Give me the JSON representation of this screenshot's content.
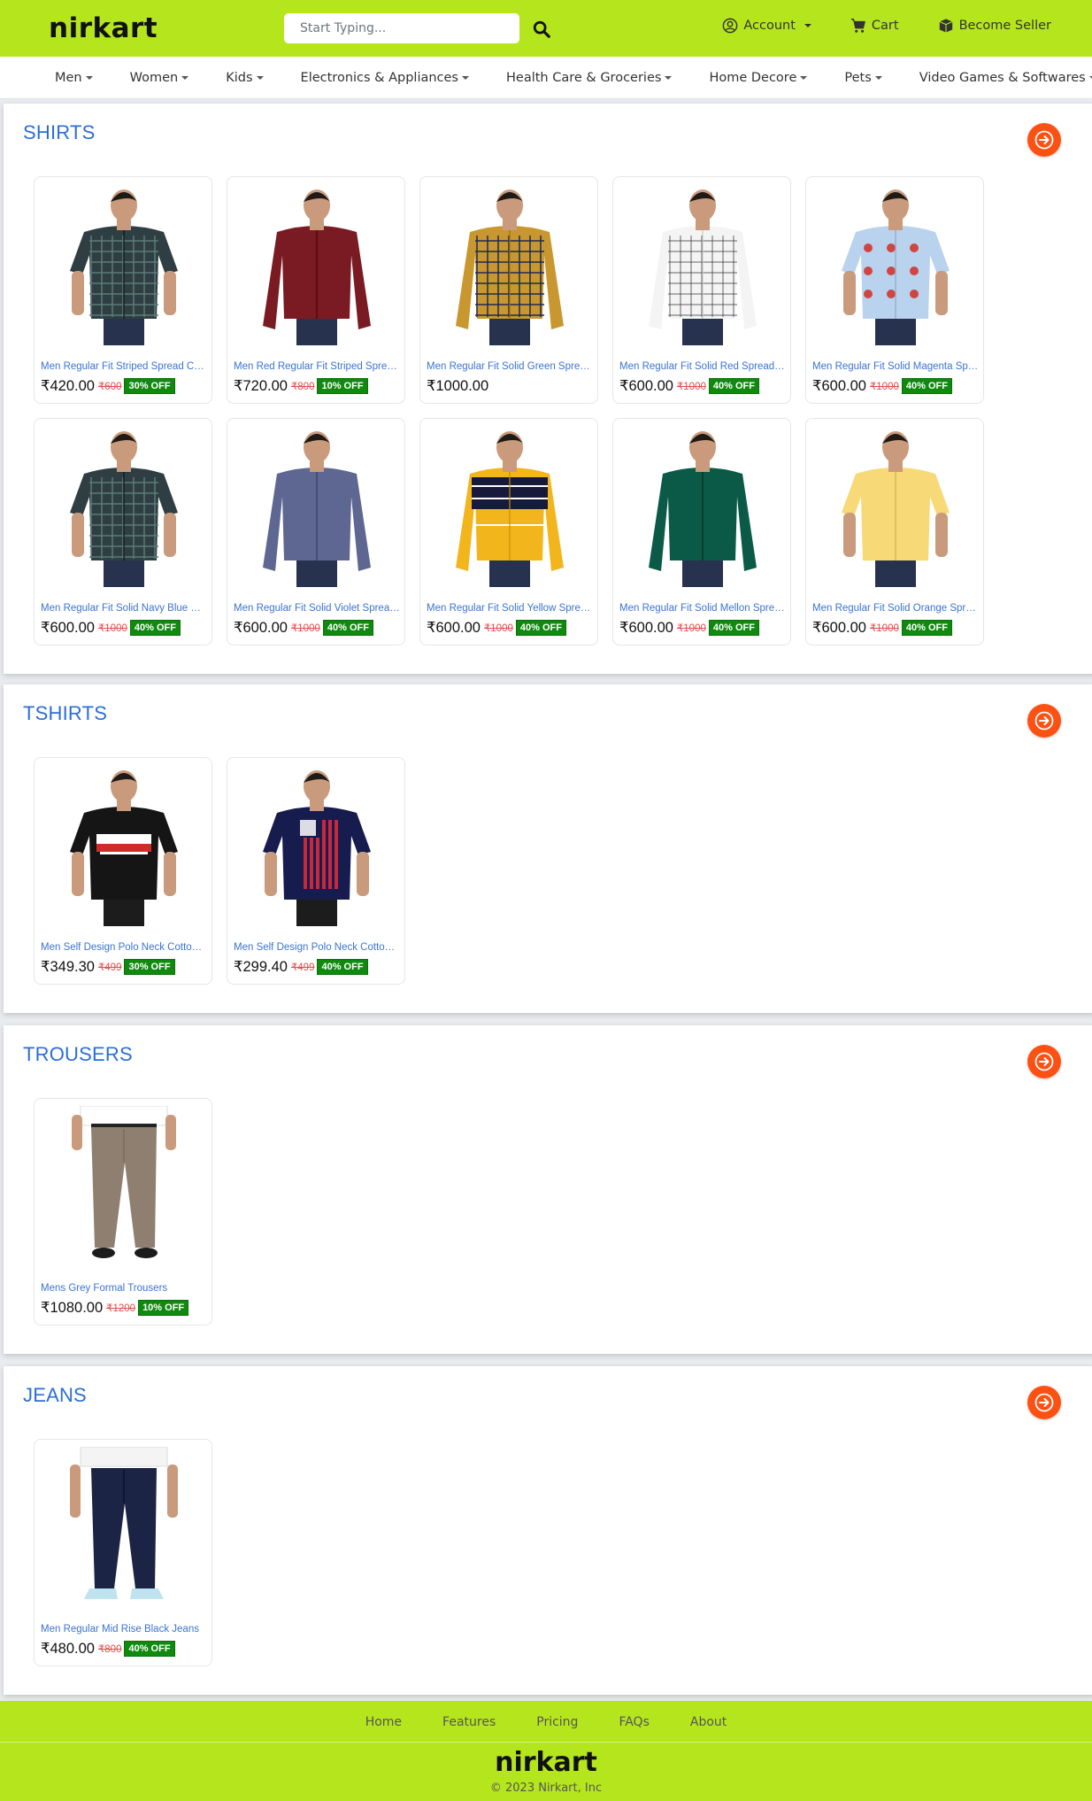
{
  "header": {
    "logo": "nirkart",
    "search_placeholder": "Start Typing...",
    "account": "Account",
    "cart": "Cart",
    "seller": "Become Seller",
    "brand_color": "#b5e61d"
  },
  "categories": [
    "Men",
    "Women",
    "Kids",
    "Electronics & Appliances",
    "Health Care & Groceries",
    "Home Decore",
    "Pets",
    "Video Games & Softwares"
  ],
  "sections": [
    {
      "title": "SHIRTS",
      "products": [
        {
          "name": "Men Regular Fit Striped Spread Collar Casual Shirt",
          "price": "₹420.00",
          "mrp": "₹600",
          "off": "30% OFF",
          "kind": "shirt",
          "color": "#2f3e42",
          "pattern": "check-dark"
        },
        {
          "name": "Men Red Regular Fit Striped Spread Collar Casual Shirt",
          "price": "₹720.00",
          "mrp": "₹800",
          "off": "10% OFF",
          "kind": "shirt",
          "color": "#7a1a22",
          "pattern": "plain"
        },
        {
          "name": "Men Regular Fit Solid Green Spread Collar Casual Shirt",
          "price": "₹1000.00",
          "mrp": "",
          "off": "",
          "kind": "shirt",
          "color": "#c8972f",
          "pattern": "check-navy"
        },
        {
          "name": "Men Regular Fit Solid Red Spread Collar Casual Shirt",
          "price": "₹600.00",
          "mrp": "₹1000",
          "off": "40% OFF",
          "kind": "shirt",
          "color": "#f4f4f4",
          "pattern": "check-light"
        },
        {
          "name": "Men Regular Fit Solid Magenta Spread Collar Casual Shirt",
          "price": "₹600.00",
          "mrp": "₹1000",
          "off": "40% OFF",
          "kind": "shirt",
          "color": "#b9d2ee",
          "pattern": "print"
        },
        {
          "name": "Men Regular Fit Solid Navy Blue Spread Collar Casual Shirt",
          "price": "₹600.00",
          "mrp": "₹1000",
          "off": "40% OFF",
          "kind": "shirt",
          "color": "#2f3e42",
          "pattern": "check-dark"
        },
        {
          "name": "Men Regular Fit Solid Violet Spread Collar Casual Shirt",
          "price": "₹600.00",
          "mrp": "₹1000",
          "off": "40% OFF",
          "kind": "shirt",
          "color": "#5d6791",
          "pattern": "plain"
        },
        {
          "name": "Men Regular Fit Solid Yellow Spread Collar Casual Shirt",
          "price": "₹600.00",
          "mrp": "₹1000",
          "off": "40% OFF",
          "kind": "shirt",
          "color": "#f2b61c",
          "pattern": "stripe"
        },
        {
          "name": "Men Regular Fit Solid Mellon Spread Collar Casual Shirt",
          "price": "₹600.00",
          "mrp": "₹1000",
          "off": "40% OFF",
          "kind": "shirt",
          "color": "#0b5a47",
          "pattern": "plain"
        },
        {
          "name": "Men Regular Fit Solid Orange Spread Collar Casual Shirt",
          "price": "₹600.00",
          "mrp": "₹1000",
          "off": "40% OFF",
          "kind": "shirt",
          "color": "#f7d978",
          "pattern": "plain"
        }
      ]
    },
    {
      "title": "TSHIRTS",
      "products": [
        {
          "name": "Men Self Design Polo Neck Cotton Blend T-Shirt",
          "price": "₹349.30",
          "mrp": "₹499",
          "off": "30% OFF",
          "kind": "tshirt",
          "color": "#151515",
          "pattern": "tommy"
        },
        {
          "name": "Men Self Design Polo Neck Cotton Blend T-Shirt",
          "price": "₹299.40",
          "mrp": "₹499",
          "off": "40% OFF",
          "kind": "tshirt",
          "color": "#161c4d",
          "pattern": "flag"
        }
      ]
    },
    {
      "title": "TROUSERS",
      "products": [
        {
          "name": "Mens Grey Formal Trousers",
          "price": "₹1080.00",
          "mrp": "₹1200",
          "off": "10% OFF",
          "kind": "trouser",
          "color": "#8f7f70",
          "pattern": "plain"
        }
      ]
    },
    {
      "title": "JEANS",
      "products": [
        {
          "name": "Men Regular Mid Rise Black Jeans",
          "price": "₹480.00",
          "mrp": "₹800",
          "off": "40% OFF",
          "kind": "jeans",
          "color": "#1b2444",
          "pattern": "plain"
        }
      ]
    }
  ],
  "footer": {
    "links": [
      "Home",
      "Features",
      "Pricing",
      "FAQs",
      "About"
    ],
    "logo": "nirkart",
    "copyright": "© 2023 Nirkart, Inc"
  },
  "colors": {
    "accent": "#fd5113",
    "title": "#2b6ed6",
    "discount": "#0f8a0f"
  }
}
